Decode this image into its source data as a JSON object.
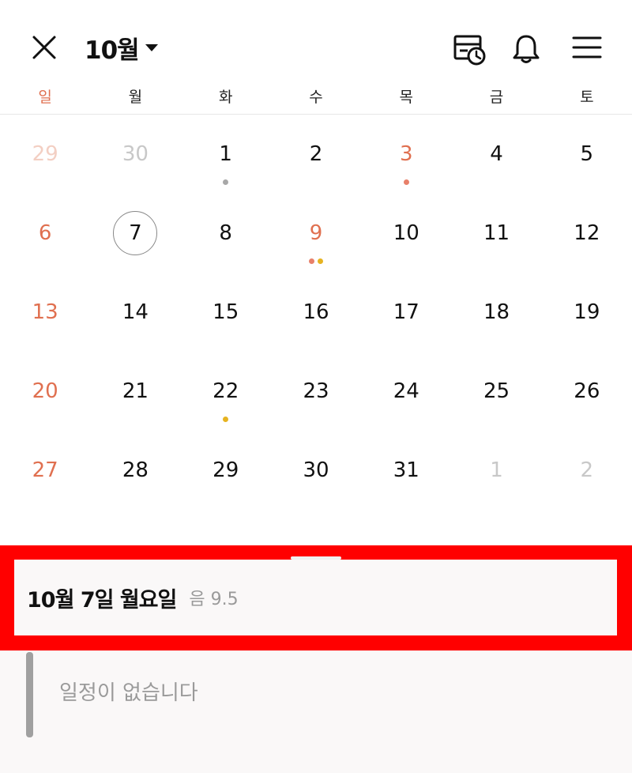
{
  "header": {
    "month_label": "10월",
    "icons": {
      "close": "close-icon",
      "month_caret": "caret-down-icon",
      "schedule_history": "calendar-clock-icon",
      "notifications": "bell-icon",
      "menu": "hamburger-menu-icon"
    }
  },
  "weekdays": [
    "일",
    "월",
    "화",
    "수",
    "목",
    "금",
    "토"
  ],
  "weeks": [
    [
      {
        "day": "29",
        "other": true
      },
      {
        "day": "30",
        "other": true
      },
      {
        "day": "1",
        "dots": [
          "#a8a8a8"
        ]
      },
      {
        "day": "2"
      },
      {
        "day": "3",
        "holiday": true,
        "dots": [
          "#e8806a"
        ]
      },
      {
        "day": "4"
      },
      {
        "day": "5"
      }
    ],
    [
      {
        "day": "6"
      },
      {
        "day": "7",
        "today": true
      },
      {
        "day": "8"
      },
      {
        "day": "9",
        "holiday": true,
        "dots": [
          "#e8806a",
          "#e6b321"
        ]
      },
      {
        "day": "10"
      },
      {
        "day": "11"
      },
      {
        "day": "12"
      }
    ],
    [
      {
        "day": "13"
      },
      {
        "day": "14"
      },
      {
        "day": "15"
      },
      {
        "day": "16"
      },
      {
        "day": "17"
      },
      {
        "day": "18"
      },
      {
        "day": "19"
      }
    ],
    [
      {
        "day": "20"
      },
      {
        "day": "21"
      },
      {
        "day": "22",
        "dots": [
          "#e6b321"
        ]
      },
      {
        "day": "23"
      },
      {
        "day": "24"
      },
      {
        "day": "25"
      },
      {
        "day": "26"
      }
    ],
    [
      {
        "day": "27"
      },
      {
        "day": "28"
      },
      {
        "day": "29"
      },
      {
        "day": "30"
      },
      {
        "day": "31"
      },
      {
        "day": "1",
        "other": true
      },
      {
        "day": "2",
        "other": true
      }
    ]
  ],
  "selected_date": {
    "title": "10월 7일 월요일",
    "lunar": "음 9.5"
  },
  "events": {
    "empty_text": "일정이 없습니다"
  },
  "colors": {
    "sunday": "#e07050",
    "holiday": "#e07050",
    "highlight": "#ff0000",
    "muted": "#c8c8c8"
  }
}
